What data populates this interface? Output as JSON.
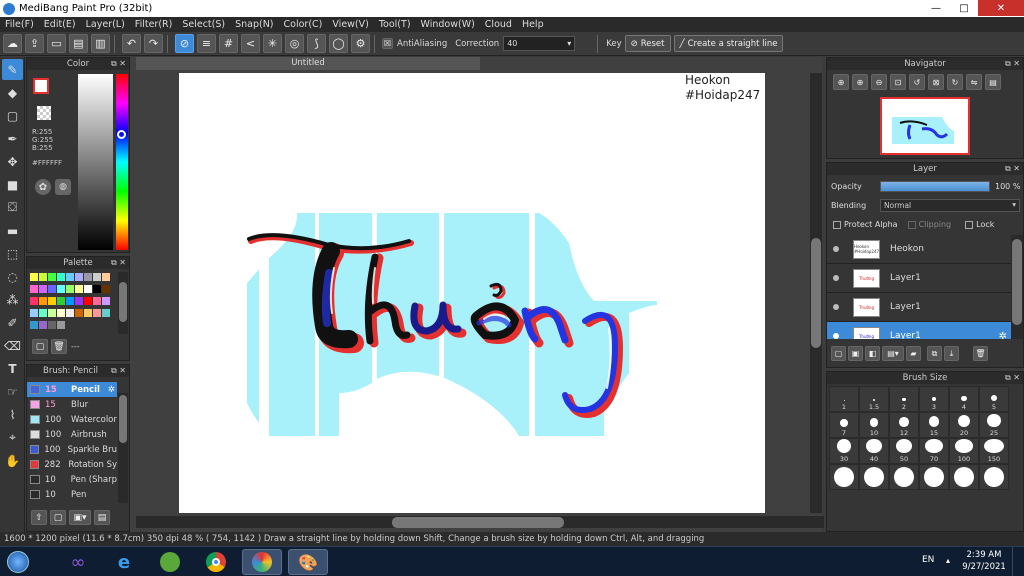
{
  "title": "MediBang Paint Pro (32bit)",
  "window_controls": {
    "minimize": "—",
    "maximize": "□",
    "close": "✕"
  },
  "menu": [
    "File(F)",
    "Edit(E)",
    "Layer(L)",
    "Filter(R)",
    "Select(S)",
    "Snap(N)",
    "Color(C)",
    "View(V)",
    "Tool(T)",
    "Window(W)",
    "Cloud",
    "Help"
  ],
  "toolbar": {
    "antialiasing": "AntiAliasing",
    "correction_label": "Correction",
    "correction_value": "40",
    "key_label": "Key",
    "reset": "Reset",
    "straight_line": "Create a straight line"
  },
  "color_panel": {
    "title": "Color",
    "r": "R:255",
    "g": "G:255",
    "b": "B:255",
    "hex": "#FFFFFF"
  },
  "palette_panel": {
    "title": "Palette",
    "label": "---"
  },
  "brush_panel": {
    "title": "Brush: Pencil",
    "items": [
      {
        "size": "15",
        "name": "Pencil",
        "color": "#4466dd"
      },
      {
        "size": "15",
        "name": "Blur",
        "color": "#f4a4e4"
      },
      {
        "size": "100",
        "name": "Watercolor",
        "color": "#9ee8f6"
      },
      {
        "size": "100",
        "name": "Airbrush",
        "color": "#dddddd"
      },
      {
        "size": "100",
        "name": "Sparkle Bru",
        "color": "#3b5bd6"
      },
      {
        "size": "282",
        "name": "Rotation Sy",
        "color": "#e03a3a"
      },
      {
        "size": "10",
        "name": "Pen (Sharp",
        "color": "#2a2a2a"
      },
      {
        "size": "10",
        "name": "Pen",
        "color": "#2a2a2a"
      }
    ]
  },
  "document": {
    "tab": "Untitled",
    "watermark_line1": "Heokon",
    "watermark_line2": "#Hoidap247",
    "lettering": "Thường"
  },
  "navigator": {
    "title": "Navigator"
  },
  "layer_panel": {
    "title": "Layer",
    "opacity_label": "Opacity",
    "opacity_value": "100 %",
    "opacity_fraction": 1.0,
    "blending_label": "Blending",
    "blending_value": "Normal",
    "protect_alpha": "Protect Alpha",
    "clipping": "Clipping",
    "lock": "Lock",
    "layers": [
      {
        "name": "Heokon",
        "thumb": "Heokon #Hoidap247"
      },
      {
        "name": "Layer1",
        "thumb": "Thường"
      },
      {
        "name": "Layer1",
        "thumb": "Thường"
      },
      {
        "name": "Layer1",
        "thumb": "Thường"
      }
    ]
  },
  "brush_size": {
    "title": "Brush Size",
    "sizes": [
      "1",
      "1.5",
      "2",
      "3",
      "4",
      "5",
      "7",
      "10",
      "12",
      "15",
      "20",
      "25",
      "30",
      "40",
      "50",
      "70",
      "100",
      "150"
    ]
  },
  "status": "1600 * 1200 pixel  (11.6 * 8.7cm)  350 dpi  48 %  ( 754, 1142 )  Draw a straight line by holding down Shift, Change a brush size by holding down Ctrl, Alt, and dragging",
  "taskbar": {
    "lang": "EN",
    "time": "2:39 AM",
    "date": "9/27/2021"
  },
  "colors": {
    "accent": "#3c8ad8",
    "cyan": "#a7f0fa",
    "red": "#e53030",
    "black": "#111111",
    "blue": "#2434e0"
  }
}
